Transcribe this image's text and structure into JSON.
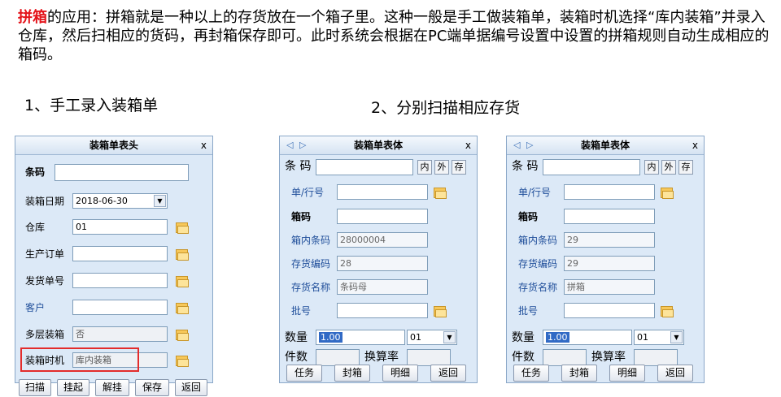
{
  "intro": {
    "highlight": "拼箱",
    "text": "的应用：拼箱就是一种以上的存货放在一个箱子里。这种一般是手工做装箱单，装箱时机选择“库内装箱”并录入仓库，然后扫相应的货码，再封箱保存即可。此时系统会根据在PC端单据编号设置中设置的拼箱规则自动生成相应的箱码。"
  },
  "steps": {
    "step1": "1、手工录入装箱单",
    "step2": "2、分别扫描相应存货"
  },
  "header_window": {
    "title": "装箱单表头",
    "close": "x",
    "barcode_label": "条码",
    "barcode_value": "",
    "date_label": "装箱日期",
    "date_value": "2018-06-30",
    "warehouse_label": "仓库",
    "warehouse_value": "01",
    "order_label": "生产订单",
    "order_value": "",
    "ship_label": "发货单号",
    "ship_value": "",
    "customer_label": "客户",
    "customer_value": "",
    "multilayer_label": "多层装箱",
    "multilayer_value": "否",
    "timing_label": "装箱时机",
    "timing_value": "库内装箱",
    "buttons": [
      "扫描",
      "挂起",
      "解挂",
      "保存",
      "返回"
    ]
  },
  "body_window_1": {
    "title": "装箱单表体",
    "nav_prev": "◁",
    "nav_next": "▷",
    "close": "x",
    "barcode_label": "条 码",
    "barcode_value": "",
    "tag_in": "内",
    "tag_out": "外",
    "tag_stock": "存",
    "line_label": "单/行号",
    "line_value": "",
    "box_label": "箱码",
    "box_value": "",
    "inner_label": "箱内条码",
    "inner_value": "28000004",
    "inv_code_label": "存货编码",
    "inv_code_value": "28",
    "inv_name_label": "存货名称",
    "inv_name_value": "条码母",
    "batch_label": "批号",
    "batch_value": "",
    "qty_label": "数量",
    "qty_value": "1.00",
    "unit_value": "01",
    "pieces_label": "件数",
    "pieces_value": "",
    "rate_label": "换算率",
    "rate_value": "",
    "buttons": [
      "任务",
      "封箱",
      "明细",
      "返回"
    ]
  },
  "body_window_2": {
    "title": "装箱单表体",
    "nav_prev": "◁",
    "nav_next": "▷",
    "close": "x",
    "barcode_label": "条 码",
    "barcode_value": "",
    "tag_in": "内",
    "tag_out": "外",
    "tag_stock": "存",
    "line_label": "单/行号",
    "line_value": "",
    "box_label": "箱码",
    "box_value": "",
    "inner_label": "箱内条码",
    "inner_value": "29",
    "inv_code_label": "存货编码",
    "inv_code_value": "29",
    "inv_name_label": "存货名称",
    "inv_name_value": "拼箱",
    "batch_label": "批号",
    "batch_value": "",
    "qty_label": "数量",
    "qty_value": "1.00",
    "unit_value": "01",
    "pieces_label": "件数",
    "pieces_value": "",
    "rate_label": "换算率",
    "rate_value": "",
    "buttons": [
      "任务",
      "封箱",
      "明细",
      "返回"
    ]
  },
  "colors": {
    "highlight": "#e4141b",
    "window_bg": "#dce9f7",
    "label_blue": "#1f4e9a",
    "annotation_box": "#e32c2c"
  },
  "icons": [
    "folder-icon",
    "chevron-down-icon",
    "close-icon",
    "nav-prev-icon",
    "nav-next-icon"
  ]
}
